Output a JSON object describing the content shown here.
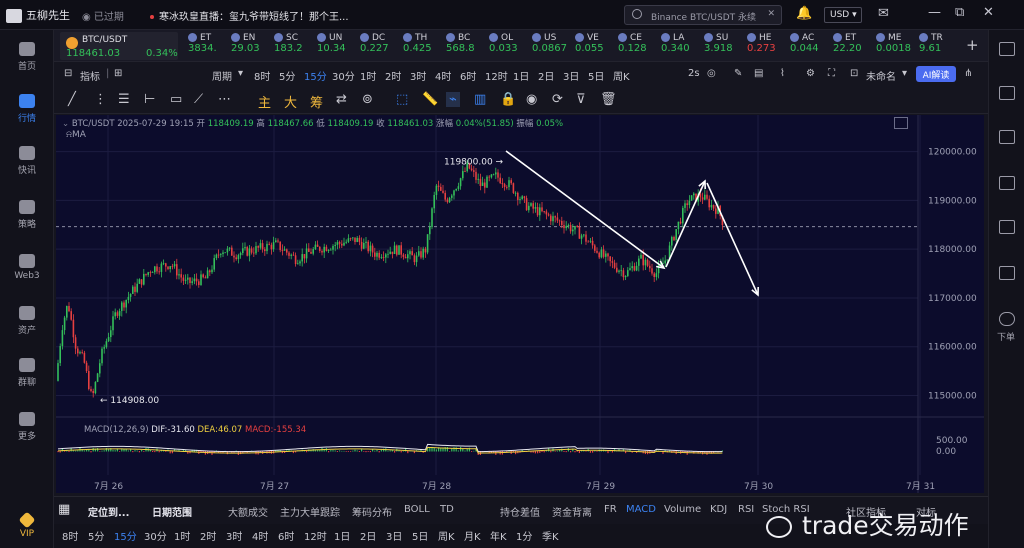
{
  "app": {
    "name": "五柳先生",
    "status": "已过期",
    "news": "寒冰玖皇直播：玺九爷带短线了！那个王..."
  },
  "search": {
    "placeholder": "Binance BTC/USDT 永续"
  },
  "currency": "USD",
  "leftnav": [
    {
      "label": "首页",
      "icon": "home-icon"
    },
    {
      "label": "行情",
      "icon": "chart-bars-icon",
      "active": true
    },
    {
      "label": "快讯",
      "icon": "news-icon"
    },
    {
      "label": "策略",
      "icon": "robot-icon"
    },
    {
      "label": "Web3",
      "icon": "web3-icon"
    },
    {
      "label": "资产",
      "icon": "wallet-icon"
    },
    {
      "label": "群聊",
      "icon": "chat-icon"
    },
    {
      "label": "更多",
      "icon": "grid-icon"
    },
    {
      "label": "VIP",
      "icon": "diamond-icon"
    }
  ],
  "rightbar": {
    "download_label": "下单"
  },
  "ticker_main": {
    "symbol": "BTC/USDT",
    "price": "118461.03",
    "change": "0.34%"
  },
  "tickers": [
    {
      "s": "ET",
      "p": "3834.",
      "dir": "up"
    },
    {
      "s": "EN",
      "p": "29.03",
      "dir": "up"
    },
    {
      "s": "SC",
      "p": "183.2",
      "dir": "up"
    },
    {
      "s": "UN",
      "p": "10.34",
      "dir": "up"
    },
    {
      "s": "DC",
      "p": "0.227",
      "dir": "up"
    },
    {
      "s": "TH",
      "p": "0.425",
      "dir": "up"
    },
    {
      "s": "BC",
      "p": "568.8",
      "dir": "up"
    },
    {
      "s": "OL",
      "p": "0.033",
      "dir": "up"
    },
    {
      "s": "US",
      "p": "0.0867",
      "dir": "up"
    },
    {
      "s": "VE",
      "p": "0.055",
      "dir": "up"
    },
    {
      "s": "CE",
      "p": "0.128",
      "dir": "up"
    },
    {
      "s": "LA",
      "p": "0.340",
      "dir": "up"
    },
    {
      "s": "SU",
      "p": "3.918",
      "dir": "up"
    },
    {
      "s": "HE",
      "p": "0.273",
      "dir": "down"
    },
    {
      "s": "AC",
      "p": "0.044",
      "dir": "up"
    },
    {
      "s": "ET",
      "p": "22.20",
      "dir": "up"
    },
    {
      "s": "ME",
      "p": "0.0018",
      "dir": "up"
    },
    {
      "s": "TR",
      "p": "9.61",
      "dir": "up"
    }
  ],
  "toolbar": {
    "indicator": "指标",
    "period": "周期",
    "intervals": [
      "8时",
      "5分",
      "15分",
      "30分",
      "1时",
      "2时",
      "3时",
      "4时",
      "6时",
      "12时",
      "1日",
      "2日",
      "3日",
      "5日",
      "周K"
    ],
    "active_interval": "15分",
    "refresh": "2s",
    "unnamed": "未命名",
    "ai": "AI解读"
  },
  "drawtools": {
    "labels": [
      "主",
      "大",
      "筹"
    ]
  },
  "chart_data": {
    "type": "candlestick",
    "symbol": "BTC/USDT",
    "header": {
      "date": "2025-07-29 19:15",
      "open": "118409.19",
      "high": "118467.66",
      "low": "118409.19",
      "close": "118461.03",
      "change": "0.04%(51.85)",
      "amplitude": "0.05%"
    },
    "ma_label": "MA",
    "y_ticks": [
      "120000.00",
      "119000.00",
      "118000.00",
      "117000.00",
      "116000.00",
      "115000.00"
    ],
    "ylim": [
      114600,
      120300
    ],
    "x_ticks": [
      "7月 26",
      "7月 27",
      "7月 28",
      "7月 29",
      "7月 30",
      "7月 31"
    ],
    "annotations": {
      "high_label": "119800.00",
      "low_label": "114908.00"
    },
    "current_price_line": 118461.03,
    "macd": {
      "label": "MACD(12,26,9)",
      "dif": "DIF:-31.60",
      "dea": "DEA:46.07",
      "macd": "MACD:-155.34",
      "ticks": [
        "500.00",
        "0.00"
      ]
    }
  },
  "bottom_tabs": {
    "items": [
      "定位到...",
      "日期范围",
      "大额成交",
      "主力大单跟踪",
      "筹码分布",
      "BOLL",
      "TD",
      "持仓差值",
      "资金背离",
      "FR",
      "MACD",
      "Volume",
      "KDJ",
      "RSI",
      "Stoch RSI",
      "社区指标",
      "对标"
    ],
    "active": "MACD"
  },
  "period_bar": {
    "items": [
      "8时",
      "5分",
      "15分",
      "30分",
      "1时",
      "2时",
      "3时",
      "4时",
      "6时",
      "12时",
      "1日",
      "2日",
      "3日",
      "5日",
      "周K",
      "月K",
      "年K",
      "1分",
      "季K"
    ],
    "active": "15分"
  },
  "watermark": {
    "text": "trade交易动作"
  }
}
